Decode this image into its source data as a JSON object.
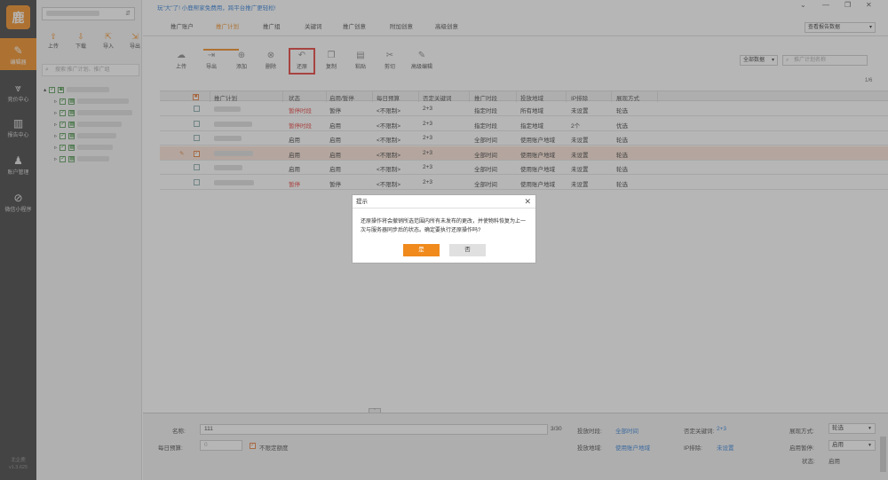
{
  "nav": {
    "logo": "鹿",
    "items": [
      {
        "icon": "✎",
        "label": "编辑器"
      },
      {
        "icon": "⩔",
        "label": "竞价中心"
      },
      {
        "icon": "▥",
        "label": "报告中心"
      },
      {
        "icon": "♟",
        "label": "账户管理"
      },
      {
        "icon": "⊘",
        "label": "微信小程序"
      }
    ],
    "footer_line1": "北企鹿",
    "footer_line2": "v1.3.625"
  },
  "tree": {
    "account_caret": "⇵",
    "buttons": [
      {
        "icon": "⇧",
        "label": "上传"
      },
      {
        "icon": "⇩",
        "label": "下载"
      },
      {
        "icon": "⇱",
        "label": "导入"
      },
      {
        "icon": "⇲",
        "label": "导出"
      }
    ],
    "search_placeholder": "搜索:推广计划、推广组"
  },
  "notice": "玩\"大\"了! 小鹿帮家免费用，跨平台推广更轻松!",
  "tabs": [
    "推广账户",
    "推广计划",
    "推广组",
    "关键词",
    "推广创意",
    "附加创意",
    "高级创意"
  ],
  "report_select": "查看报告数据",
  "toolbar": [
    {
      "icon": "☁",
      "label": "上传"
    },
    {
      "icon": "⇥",
      "label": "导出"
    },
    {
      "icon": "⊕",
      "label": "添加"
    },
    {
      "icon": "⊗",
      "label": "删除"
    },
    {
      "icon": "↶",
      "label": "还原"
    },
    {
      "icon": "❐",
      "label": "复制"
    },
    {
      "icon": "▤",
      "label": "粘贴"
    },
    {
      "icon": "✂",
      "label": "剪切"
    },
    {
      "icon": "✎",
      "label": "高级编辑"
    }
  ],
  "scope_select": "全部数据",
  "plan_search_placeholder": "推广计划名称",
  "page_info": "1/6",
  "table": {
    "headers": [
      "推广计划",
      "状态",
      "启用/暂停",
      "每日预算",
      "否定关键词",
      "推广时段",
      "投放地域",
      "IP排除",
      "展现方式"
    ],
    "rows": [
      {
        "status": "暂停时段",
        "status_red": true,
        "enable": "暂停",
        "budget": "<不限制>",
        "neg": "2+3",
        "time": "指定时段",
        "region": "所有地域",
        "ip": "未设置",
        "show": "轮选",
        "selected": false
      },
      {
        "status": "暂停时段",
        "status_red": true,
        "enable": "启用",
        "budget": "<不限制>",
        "neg": "2+3",
        "time": "指定时段",
        "region": "指定地域",
        "ip": "2个",
        "show": "优选",
        "selected": false
      },
      {
        "status": "启用",
        "status_red": false,
        "enable": "启用",
        "budget": "<不限制>",
        "neg": "2+3",
        "time": "全部时间",
        "region": "使用账户地域",
        "ip": "未设置",
        "show": "轮选",
        "selected": false
      },
      {
        "status": "启用",
        "status_red": false,
        "enable": "启用",
        "budget": "<不限制>",
        "neg": "2+3",
        "time": "全部时间",
        "region": "使用账户地域",
        "ip": "未设置",
        "show": "轮选",
        "selected": true
      },
      {
        "status": "启用",
        "status_red": false,
        "enable": "启用",
        "budget": "<不限制>",
        "neg": "2+3",
        "time": "全部时间",
        "region": "使用账户地域",
        "ip": "未设置",
        "show": "轮选",
        "selected": false
      },
      {
        "status": "暂停",
        "status_red": true,
        "enable": "暂停",
        "budget": "<不限制>",
        "neg": "2+3",
        "time": "全部时间",
        "region": "使用账户地域",
        "ip": "未设置",
        "show": "轮选",
        "selected": false
      }
    ]
  },
  "dialog": {
    "title": "提示",
    "message": "还原操作将会撤销所选范围内所有未发布的更改，并使物料恢复为上一次与服务器同步后的状态。确定要执行还原操作吗?",
    "yes": "是",
    "no": "否"
  },
  "bottom": {
    "name_label": "名称:",
    "name_value": "111",
    "name_count": "3/30",
    "budget_label": "每日预算:",
    "budget_value": "0",
    "unlimited_label": "不限定额度",
    "time_label": "投放时段:",
    "time_value": "全部时间",
    "region_label": "投放地域:",
    "region_value": "使用账户地域",
    "neg_label": "否定关键词:",
    "neg_value": "2+3",
    "ip_label": "IP排除:",
    "ip_value": "未设置",
    "show_label": "展现方式:",
    "show_value": "轮选",
    "enable_label": "启用暂停:",
    "enable_value": "启用",
    "status_label": "状态:",
    "status_value": "启用"
  }
}
